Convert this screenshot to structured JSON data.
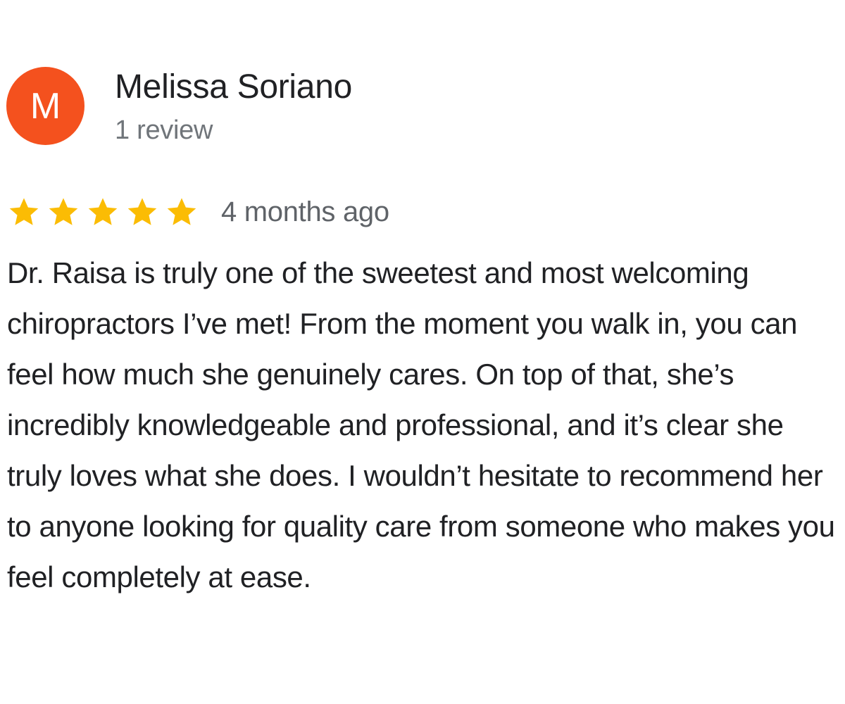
{
  "review": {
    "author": {
      "initial": "M",
      "name": "Melissa Soriano",
      "review_count_text": "1 review",
      "avatar_color": "#f4511e"
    },
    "rating": {
      "stars": 5,
      "max_stars": 5,
      "star_color": "#fbbc04",
      "icon": "star-icon"
    },
    "date": "4 months ago",
    "text": "Dr. Raisa is truly one of the sweetest and most welcoming chiropractors I’ve met! From the moment you walk in, you can feel how much she genuinely cares. On top of that, she’s incredibly knowledgeable and professional, and it’s clear she truly loves what she does. I wouldn’t hesitate to recommend her to anyone looking for quality care from someone who makes you feel completely at ease."
  }
}
